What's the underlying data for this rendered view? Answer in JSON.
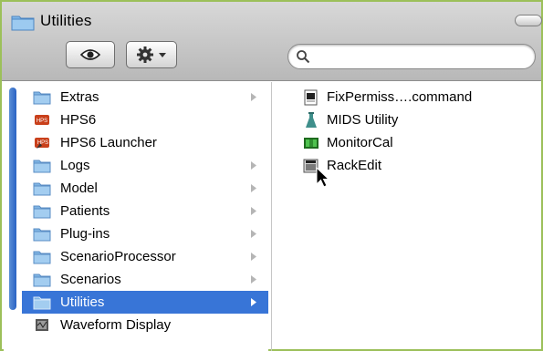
{
  "window": {
    "title": "Utilities",
    "accent_color": "#3875d7",
    "frame_color": "#9cc05a"
  },
  "toolbar": {
    "view_button_icon": "eye-icon",
    "action_button_icon": "gear-icon",
    "search_placeholder": ""
  },
  "column1": {
    "items": [
      {
        "label": "Extras",
        "icon": "folder-icon",
        "has_children": true
      },
      {
        "label": "HPS6",
        "icon": "hps-app-icon",
        "has_children": false
      },
      {
        "label": "HPS6 Launcher",
        "icon": "hps-launcher-icon",
        "has_children": false
      },
      {
        "label": "Logs",
        "icon": "folder-icon",
        "has_children": true
      },
      {
        "label": "Model",
        "icon": "folder-icon",
        "has_children": true
      },
      {
        "label": "Patients",
        "icon": "folder-icon",
        "has_children": true
      },
      {
        "label": "Plug-ins",
        "icon": "folder-icon",
        "has_children": true
      },
      {
        "label": "ScenarioProcessor",
        "icon": "folder-icon",
        "has_children": true
      },
      {
        "label": "Scenarios",
        "icon": "folder-icon",
        "has_children": true
      },
      {
        "label": "Utilities",
        "icon": "folder-icon",
        "has_children": true,
        "selected": true
      },
      {
        "label": "Waveform Display",
        "icon": "app-icon",
        "has_children": false
      }
    ]
  },
  "column2": {
    "items": [
      {
        "label": "FixPermiss….command",
        "icon": "script-file-icon"
      },
      {
        "label": "MIDS Utility",
        "icon": "mids-app-icon"
      },
      {
        "label": "MonitorCal",
        "icon": "monitor-app-icon"
      },
      {
        "label": "RackEdit",
        "icon": "rackedit-app-icon"
      }
    ]
  }
}
